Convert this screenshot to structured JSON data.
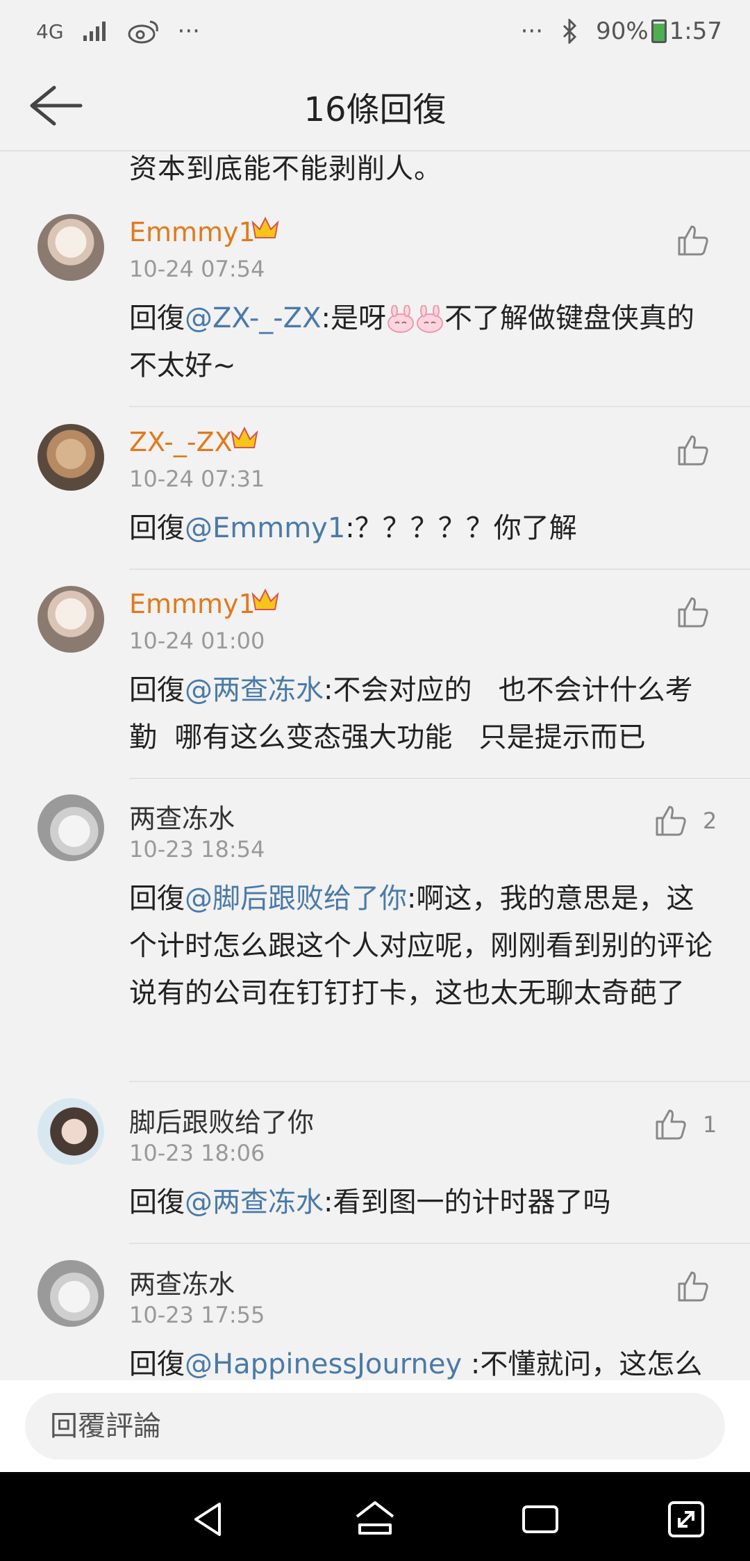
{
  "status_bar": {
    "network": "4G",
    "more_left": "···",
    "more_right": "···",
    "battery": "90%",
    "time": "1:57"
  },
  "header": {
    "title": "16條回復"
  },
  "top_cut_text": "资本到底能不能剥削人。",
  "comments": [
    {
      "username": "Emmmy1",
      "time": "10-24 07:54",
      "reply_prefix": "回復",
      "mention": "@ZX-_-ZX",
      "text_a": ":是呀",
      "text_b": "不了解做键盘侠真的不太好~",
      "likes": ""
    },
    {
      "username": "ZX-_-ZX",
      "time": "10-24 07:31",
      "reply_prefix": "回復",
      "mention": "@Emmmy1",
      "text": ":？？？？？你了解",
      "likes": ""
    },
    {
      "username": "Emmmy1",
      "time": "10-24 01:00",
      "reply_prefix": "回復",
      "mention": "@两查冻水",
      "text": ":不会对应的   也不会计什么考勤  哪有这么变态强大功能   只是提示而已",
      "likes": ""
    },
    {
      "username": "两查冻水",
      "time": "10-23 18:54",
      "reply_prefix": "回復",
      "mention": "@脚后跟败给了你",
      "text": ":啊这，我的意思是，这个计时怎么跟这个人对应呢，刚刚看到别的评论说有的公司在钉钉打卡，这也太无聊太奇葩了",
      "likes": "2"
    },
    {
      "username": "脚后跟败给了你",
      "time": "10-23 18:06",
      "reply_prefix": "回復",
      "mention": "@两查冻水",
      "text": ":看到图一的计时器了吗",
      "likes": "1"
    },
    {
      "username": "两查冻水",
      "time": "10-23 17:55",
      "reply_prefix": "回復",
      "mention": "@HappinessJourney",
      "text": " :不懂就问，这怎么",
      "likes": ""
    }
  ],
  "reply_bar": {
    "placeholder": "回覆評論"
  },
  "colors": {
    "username_vip": "#e07a1c",
    "mention": "#4a7aa8",
    "background": "#f2f2f2"
  }
}
